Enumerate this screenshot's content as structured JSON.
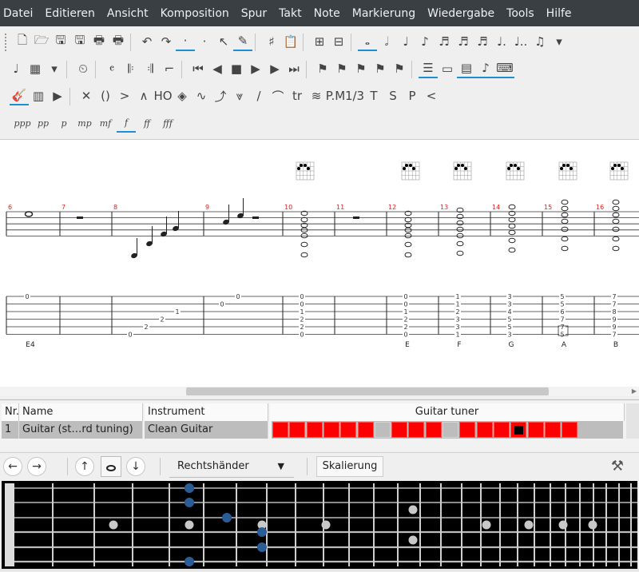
{
  "menu": [
    "Datei",
    "Editieren",
    "Ansicht",
    "Komposition",
    "Spur",
    "Takt",
    "Note",
    "Markierung",
    "Wiedergabe",
    "Tools",
    "Hilfe"
  ],
  "toolbar": {
    "row1": [
      "new-file",
      "open-file",
      "save",
      "save-as",
      "print",
      "print-preview",
      "undo",
      "redo",
      "insert-beat-1",
      "insert-beat-2",
      "cursor-tool",
      "pen-tool",
      "chord-sharp",
      "clipboard",
      "insert-measure",
      "remove-measure",
      "whole-note",
      "half-note",
      "quarter-note",
      "eighth-note",
      "sixteenth-note",
      "thirty-second-note",
      "sixty-fourth-note",
      "dotted-note",
      "double-dotted-note",
      "tuplet",
      "more"
    ],
    "row2": [
      "tie-note",
      "grid-options",
      "dropdown",
      "metronome",
      "time-signature",
      "repeat-open",
      "repeat-close",
      "alternate-ending",
      "first-measure",
      "previous-measure",
      "stop",
      "play",
      "next-measure",
      "last-measure",
      "flag-marker-1",
      "flag-marker-2",
      "flag-marker-3",
      "flag-marker-4",
      "flag-marker-5",
      "track-view",
      "page-view",
      "score-view",
      "note-view",
      "keyboard-view"
    ],
    "row3": [
      "guitar-icon",
      "mixer-icon",
      "playback-icon",
      "dead-note",
      "ghost-note",
      "accentuated-note",
      "heavy-accent",
      "natural-harmonic",
      "artificial-harmonic",
      "vibrato",
      "bend",
      "tremolo-bar",
      "slide",
      "hammer-on",
      "trill",
      "tremolo-picking",
      "palm-mute",
      "staccato",
      "tapping",
      "slapping",
      "popping",
      "fade-in"
    ],
    "triplet_label": "1/3",
    "ho_label": "HO",
    "tr_label": "tr",
    "pm_label": "P.M",
    "t_label": "T",
    "s_label": "S",
    "p_label": "P",
    "dynamics": [
      "ppp",
      "pp",
      "p",
      "mp",
      "mf",
      "f",
      "ff",
      "fff"
    ],
    "active_dynamic": "f"
  },
  "score": {
    "measure_numbers": [
      "6",
      "7",
      "8",
      "9",
      "10",
      "11",
      "12",
      "13",
      "14",
      "15",
      "16"
    ],
    "chord_labels": [
      "E4",
      "E",
      "F",
      "G",
      "A",
      "B"
    ],
    "tab_columns": [
      {
        "m": "6",
        "frets": [
          "0"
        ]
      },
      {
        "m": "8",
        "frets": [
          "0",
          "2",
          "2",
          "1"
        ]
      },
      {
        "m": "9",
        "frets": [
          "0",
          "0"
        ]
      },
      {
        "m": "10",
        "frets": [
          "0",
          "0",
          "1",
          "2",
          "2",
          "0"
        ]
      },
      {
        "m": "12",
        "frets": [
          "0",
          "0",
          "1",
          "2",
          "2",
          "0"
        ]
      },
      {
        "m": "13",
        "frets": [
          "1",
          "1",
          "2",
          "3",
          "3",
          "1"
        ]
      },
      {
        "m": "14",
        "frets": [
          "3",
          "3",
          "4",
          "5",
          "5",
          "3"
        ]
      },
      {
        "m": "15",
        "frets": [
          "5",
          "5",
          "6",
          "7",
          "7",
          "5"
        ]
      },
      {
        "m": "16",
        "frets": [
          "7",
          "7",
          "8",
          "9",
          "9",
          "7"
        ]
      }
    ],
    "accent_color": "#e02020"
  },
  "tracks": {
    "headers": {
      "nr": "Nr.",
      "name": "Name",
      "instrument": "Instrument",
      "tuner": "Guitar tuner"
    },
    "rows": [
      {
        "nr": "1",
        "name": "Guitar (st…rd tuning)",
        "instrument": "Clean Guitar"
      }
    ],
    "tuner_cells": 18,
    "tuner_gray_cells": [
      6,
      10
    ],
    "tuner_mark_cell": 14
  },
  "fretboard_toolbar": {
    "back_icon": "arrow-left-icon",
    "forward_icon": "arrow-right-icon",
    "up_icon": "arrow-up-icon",
    "whole_note_icon": "whole-note-icon",
    "down_icon": "arrow-down-icon",
    "hand": "Rechtshänder",
    "scale_label": "Skalierung",
    "tool_icon": "hammer-icon"
  },
  "colors": {
    "menubar": "#3a3f44",
    "tuner_red": "#ff0000",
    "fret_dot": "#c8c8c8",
    "note_dot": "#2a5d96",
    "active_underline": "#1d8fd6"
  }
}
